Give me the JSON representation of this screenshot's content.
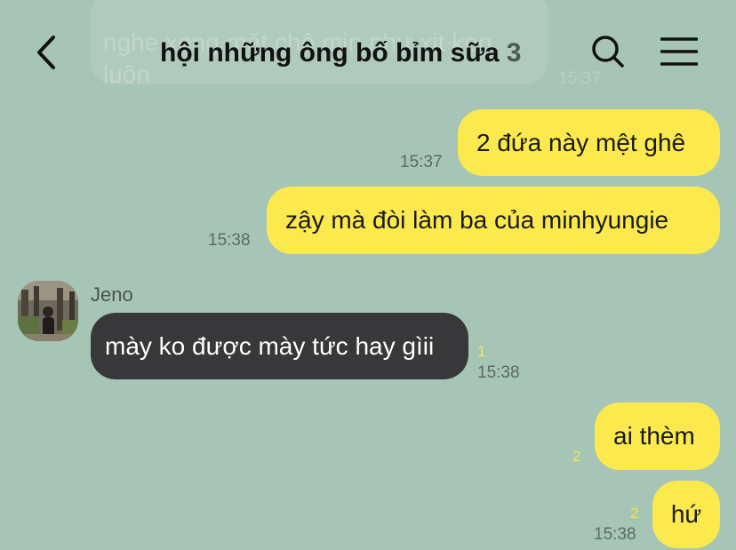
{
  "header": {
    "title": "hội những ông bố bỉm sữa",
    "member_count": "3",
    "back_icon": "chevron-left-icon",
    "search_icon": "search-icon",
    "menu_icon": "hamburger-menu-icon"
  },
  "faded_message": {
    "text": "nghe xong mặt chê min như xịt keo\nluôn",
    "time": "15:37"
  },
  "messages": [
    {
      "side": "right",
      "text": "2 đứa này mệt ghê",
      "time": "15:37",
      "unread": ""
    },
    {
      "side": "right",
      "text": "zậy mà đòi làm ba của minhyungie",
      "time": "15:38",
      "unread": ""
    },
    {
      "side": "left",
      "sender": "Jeno",
      "text": "mày ko được mày tức hay gìii",
      "time": "15:38",
      "unread": "1"
    },
    {
      "side": "right",
      "text": "ai thèm",
      "time": "",
      "unread": "2"
    },
    {
      "side": "right",
      "text": "hứ",
      "time": "15:38",
      "unread": "2"
    }
  ],
  "colors": {
    "background": "#a6c5b7",
    "my_bubble": "#fbe94e",
    "their_bubble": "#38383a",
    "unread": "#f4e44b"
  }
}
